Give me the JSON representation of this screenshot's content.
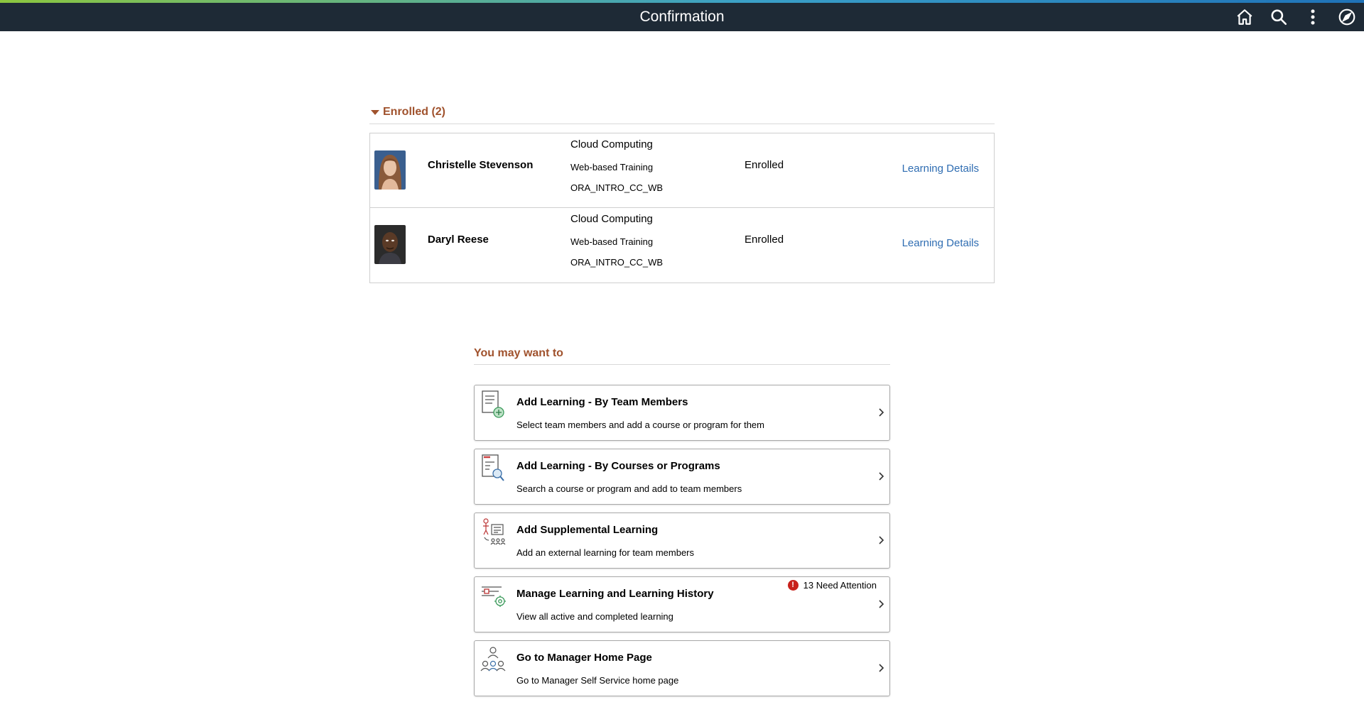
{
  "header": {
    "title": "Confirmation",
    "icons": [
      "home-icon",
      "search-icon",
      "more-options-icon",
      "navbar-compass-icon"
    ]
  },
  "enrolled": {
    "title": "Enrolled (2)",
    "rows": [
      {
        "name": "Christelle Stevenson",
        "course": "Cloud Computing",
        "type": "Web-based Training",
        "code": "ORA_INTRO_CC_WB",
        "status": "Enrolled",
        "link": "Learning Details"
      },
      {
        "name": "Daryl Reese",
        "course": "Cloud Computing",
        "type": "Web-based Training",
        "code": "ORA_INTRO_CC_WB",
        "status": "Enrolled",
        "link": "Learning Details"
      }
    ]
  },
  "related": {
    "title": "You may want to",
    "tiles": [
      {
        "title": "Add Learning - By Team Members",
        "desc": "Select team members and add a course or program for them",
        "icon": "add-learning-team-icon"
      },
      {
        "title": "Add Learning - By Courses or Programs",
        "desc": "Search a course or program and add to team members",
        "icon": "search-courses-icon"
      },
      {
        "title": "Add Supplemental Learning",
        "desc": "Add an external learning for team members",
        "icon": "supplemental-learning-icon"
      },
      {
        "title": "Manage Learning and Learning History",
        "desc": "View all active and completed learning",
        "icon": "manage-learning-icon",
        "badge": "13 Need Attention"
      },
      {
        "title": "Go to Manager Home Page",
        "desc": "Go to Manager Self Service home page",
        "icon": "manager-home-icon"
      }
    ]
  },
  "colors": {
    "header_bg": "#1e2a36",
    "section_title": "#a0522d",
    "link": "#2f6db2",
    "badge": "#c8211b"
  }
}
